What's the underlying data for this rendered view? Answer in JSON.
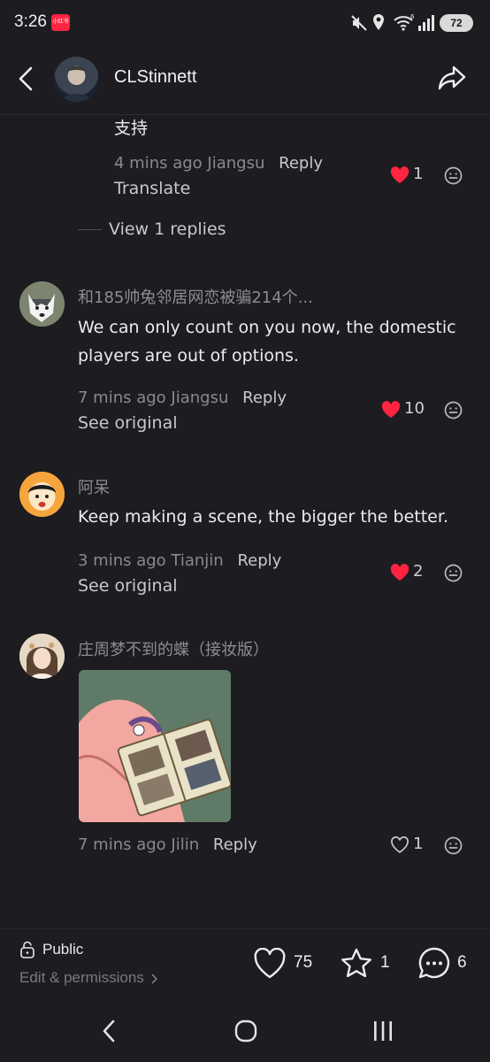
{
  "status_bar": {
    "time": "3:26",
    "app_badge": "小红书",
    "battery": "72"
  },
  "header": {
    "author_name": "CLStinnett"
  },
  "reply_partial": {
    "text": "支持",
    "time": "4 mins ago",
    "location": "Jiangsu",
    "reply_label": "Reply",
    "translate_label": "Translate",
    "likes": "1"
  },
  "view_replies": "View 1 replies",
  "comments": [
    {
      "username": "和185帅兔邻居网恋被骗214个...",
      "text": "We can only count on you now, the domestic players are out of options.",
      "time": "7 mins ago",
      "location": "Jiangsu",
      "reply_label": "Reply",
      "secondary_label": "See original",
      "likes": "10"
    },
    {
      "username": "阿呆",
      "text": "Keep making a scene, the bigger the better.",
      "time": "3 mins ago",
      "location": "Tianjin",
      "reply_label": "Reply",
      "secondary_label": "See original",
      "likes": "2"
    },
    {
      "username": "庄周梦不到的蝶（接妆版）",
      "time": "7 mins ago",
      "location": "Jilin",
      "reply_label": "Reply",
      "likes": "1"
    }
  ],
  "bottom_bar": {
    "visibility": "Public",
    "edit_label": "Edit & permissions",
    "likes": "75",
    "stars": "1",
    "comments": "6"
  },
  "colors": {
    "background": "#1d1c20",
    "like_red": "#ff2442",
    "text_primary": "#ececee",
    "text_secondary": "#8a8990"
  },
  "icons": [
    "back-arrow-icon",
    "share-icon",
    "heart-icon",
    "emoji-icon",
    "lock-icon",
    "chevron-right-icon",
    "star-icon",
    "comment-icon",
    "nav-back-icon",
    "nav-home-icon",
    "nav-recents-icon"
  ]
}
